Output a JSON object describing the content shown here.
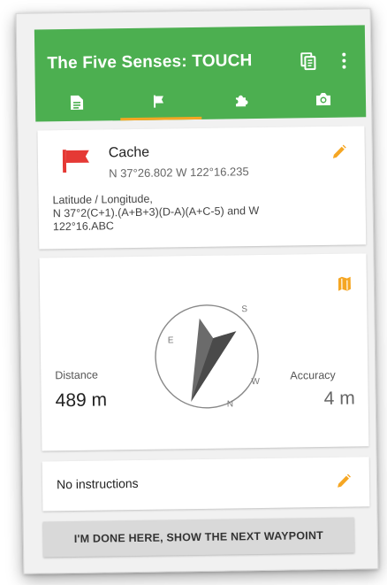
{
  "app": {
    "title": "The Five Senses: TOUCH"
  },
  "tabs": [
    {
      "icon": "document-icon"
    },
    {
      "icon": "flag-icon",
      "selected": true
    },
    {
      "icon": "puzzle-icon"
    },
    {
      "icon": "camera-icon"
    }
  ],
  "waypoint": {
    "name": "Cache",
    "coordinates": "N 37°26.802 W 122°16.235",
    "formula": "Latitude / Longitude,\nN 37°2(C+1).(A+B+3)(D-A)(A+C-5) and W 122°16.ABC"
  },
  "navigation": {
    "distance_label": "Distance",
    "distance_value": "489 m",
    "accuracy_label": "Accuracy",
    "accuracy_value": "4 m",
    "compass_letters": {
      "n": "N",
      "e": "E",
      "s": "S",
      "w": "W"
    }
  },
  "instructions": {
    "text": "No instructions"
  },
  "actions": {
    "done_label": "I'M DONE HERE, SHOW THE NEXT WAYPOINT"
  },
  "colors": {
    "appbar": "#4caf50",
    "accent": "#f5a623",
    "flag": "#e53935"
  }
}
